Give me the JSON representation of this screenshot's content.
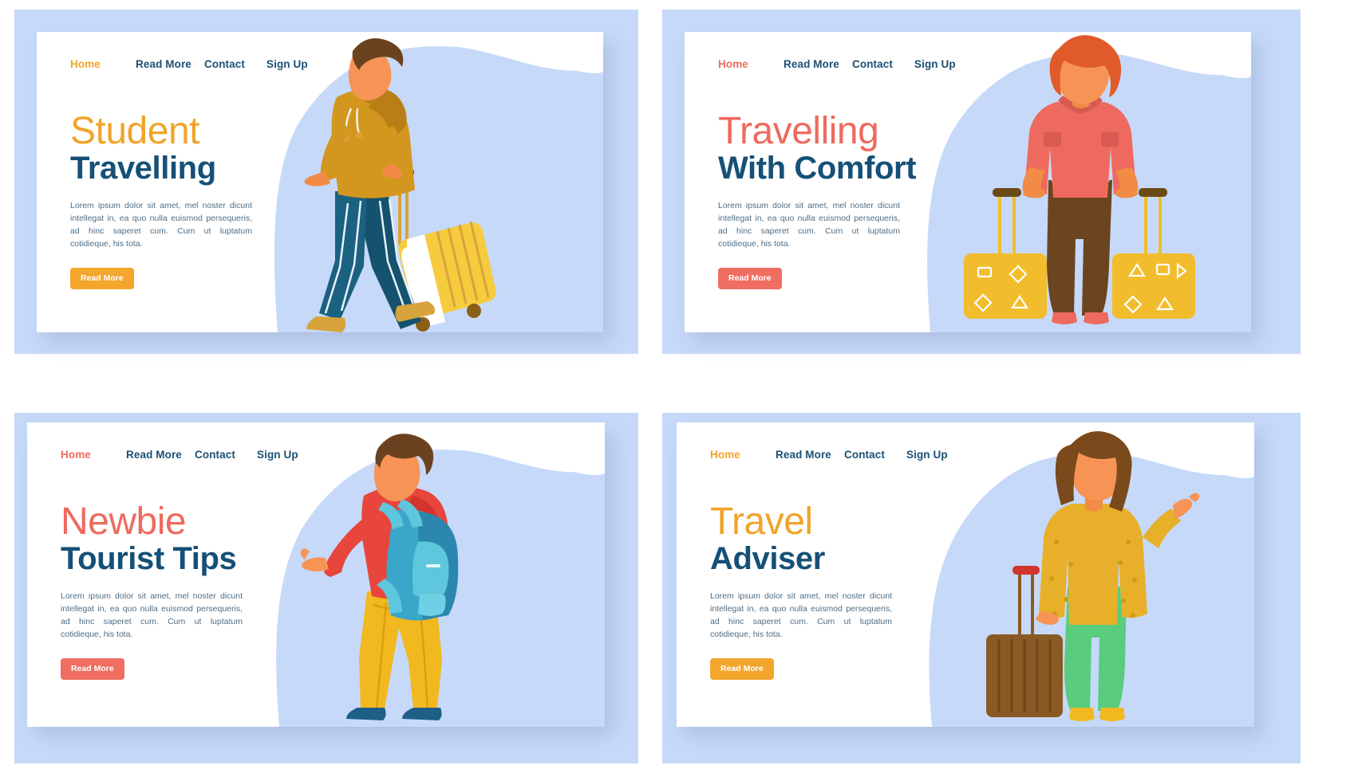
{
  "page": {
    "background_color": "#c6d9f9",
    "card_color": "#ffffff",
    "navy": "#155077",
    "orange": "#f0a42a",
    "coral": "#ee6a5e"
  },
  "shared": {
    "body_copy": "Lorem ipsum dolor sit amet, mel noster dicunt intellegat in, ea quo nulla euismod persequeris, ad hinc saperet cum. Cum ut luptatum cotidieque, his tota.",
    "nav": {
      "home": "Home",
      "read_more": "Read More",
      "contact": "Contact",
      "sign_up": "Sign Up"
    },
    "cta_label": "Read More"
  },
  "panels": [
    {
      "id": "student-travelling",
      "heading_top": "Student",
      "heading_bottom": "Travelling",
      "heading_top_color": "#f0a42a",
      "heading_bottom_color": "#155077",
      "active_nav_color": "#f0a42a",
      "cta_color": "#f3a52c",
      "illustration": "man-walking-with-yellow-rolling-suitcase"
    },
    {
      "id": "travelling-with-comfort",
      "heading_top": "Travelling",
      "heading_bottom": "With Comfort",
      "heading_top_color": "#ee6a5e",
      "heading_bottom_color": "#155077",
      "active_nav_color": "#ee6a5e",
      "cta_color": "#ef6d61",
      "illustration": "woman-standing-with-two-yellow-suitcases"
    },
    {
      "id": "newbie-tourist-tips",
      "heading_top": "Newbie",
      "heading_bottom": "Tourist Tips",
      "heading_top_color": "#ee6a5e",
      "heading_bottom_color": "#155077",
      "active_nav_color": "#ee6a5e",
      "cta_color": "#ef6d61",
      "illustration": "man-with-blue-backpack-waving"
    },
    {
      "id": "travel-adviser",
      "heading_top": "Travel",
      "heading_bottom": "Adviser",
      "heading_top_color": "#f0a42a",
      "heading_bottom_color": "#155077",
      "active_nav_color": "#f0a42a",
      "cta_color": "#f3a52c",
      "illustration": "woman-in-yellow-cardigan-with-brown-suitcase"
    }
  ]
}
